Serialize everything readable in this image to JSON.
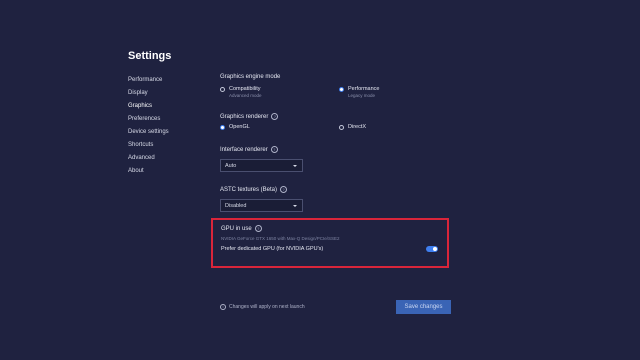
{
  "title": "Settings",
  "nav": [
    "Performance",
    "Display",
    "Graphics",
    "Preferences",
    "Device settings",
    "Shortcuts",
    "Advanced",
    "About"
  ],
  "graphics_engine": {
    "label": "Graphics engine mode",
    "options": [
      {
        "label": "Compatibility",
        "sub": "Advanced mode",
        "selected": false
      },
      {
        "label": "Performance",
        "sub": "Legacy mode",
        "selected": true
      }
    ]
  },
  "renderer": {
    "label": "Graphics renderer",
    "options": [
      {
        "label": "OpenGL",
        "selected": true
      },
      {
        "label": "DirectX",
        "selected": false
      }
    ]
  },
  "interface_renderer": {
    "label": "Interface renderer",
    "value": "Auto"
  },
  "astc": {
    "label": "ASTC textures (Beta)",
    "value": "Disabled"
  },
  "gpu": {
    "label": "GPU in use",
    "name": "NVIDIA GeForce GTX 1650 with Max-Q Design/PCIe/SSE2",
    "prefer_label": "Prefer dedicated GPU (for NVIDIA GPU's)",
    "prefer_on": true
  },
  "footer": {
    "note": "Changes will apply on next launch",
    "save_label": "Save changes"
  },
  "colors": {
    "background": "#1f2240",
    "accent": "#3f7ff0",
    "highlight_box": "#d9253a",
    "button": "#3a64b5"
  }
}
